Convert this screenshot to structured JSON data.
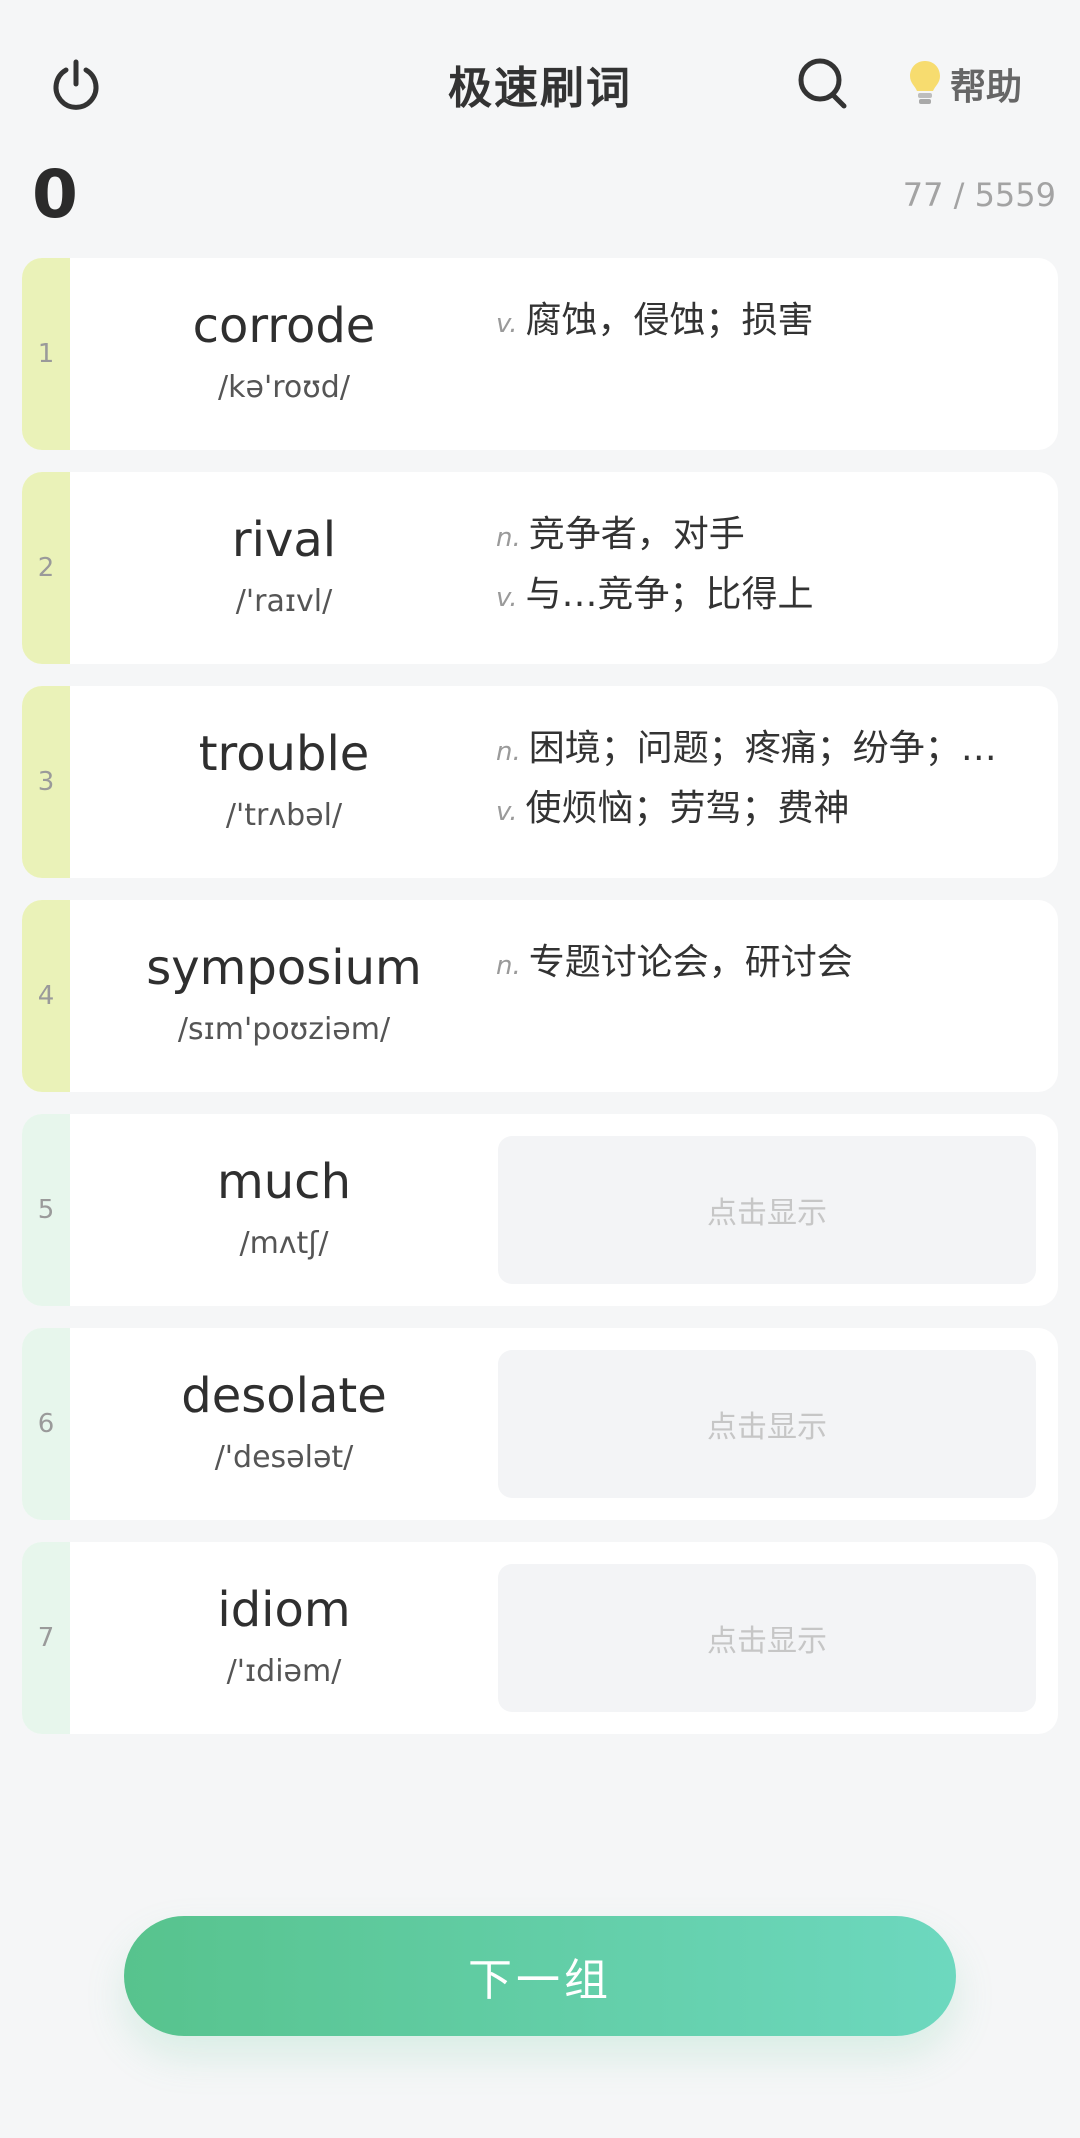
{
  "header": {
    "title": "极速刷词",
    "help_label": "帮助"
  },
  "stats": {
    "score": "0",
    "progress": "77 / 5559"
  },
  "cards": [
    {
      "index": "1",
      "word": "corrode",
      "phonetic": "/kə'roʊd/",
      "revealed": true,
      "meanings": [
        {
          "pos": "v.",
          "text": "腐蚀，侵蚀；损害"
        }
      ]
    },
    {
      "index": "2",
      "word": "rival",
      "phonetic": "/'raɪvl/",
      "revealed": true,
      "meanings": [
        {
          "pos": "n.",
          "text": "竞争者，对手"
        },
        {
          "pos": "v.",
          "text": "与…竞争；比得上"
        }
      ]
    },
    {
      "index": "3",
      "word": "trouble",
      "phonetic": "/'trʌbəl/",
      "revealed": true,
      "meanings": [
        {
          "pos": "n.",
          "text": "困境；问题；疼痛；纷争；…"
        },
        {
          "pos": "v.",
          "text": "使烦恼；劳驾；费神"
        }
      ]
    },
    {
      "index": "4",
      "word": "symposium",
      "phonetic": "/sɪm'poʊziəm/",
      "revealed": true,
      "meanings": [
        {
          "pos": "n.",
          "text": "专题讨论会，研讨会"
        }
      ]
    },
    {
      "index": "5",
      "word": "much",
      "phonetic": "/mʌtʃ/",
      "revealed": false,
      "reveal_label": "点击显示"
    },
    {
      "index": "6",
      "word": "desolate",
      "phonetic": "/'desələt/",
      "revealed": false,
      "reveal_label": "点击显示"
    },
    {
      "index": "7",
      "word": "idiom",
      "phonetic": "/'ɪdiəm/",
      "revealed": false,
      "reveal_label": "点击显示"
    }
  ],
  "next_button_label": "下一组",
  "colors": {
    "revealed_bar": "#eaf2b8",
    "hidden_bar": "#e7f6ec",
    "button_gradient_start": "#57c38d",
    "button_gradient_end": "#6dd8bf"
  },
  "icons": {
    "power": "power-icon",
    "search": "search-icon",
    "help": "lightbulb-icon"
  }
}
